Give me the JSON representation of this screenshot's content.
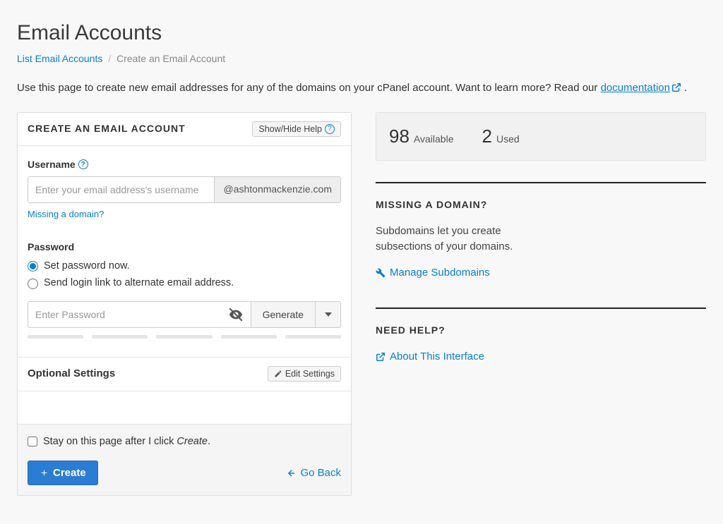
{
  "page_title": "Email Accounts",
  "breadcrumb": {
    "list": "List Email Accounts",
    "current": "Create an Email Account"
  },
  "intro": {
    "text_before": "Use this page to create new email addresses for any of the domains on your cPanel account. Want to learn more? Read our ",
    "link": "documentation",
    "text_after": " ."
  },
  "form": {
    "panel_title": "CREATE AN EMAIL ACCOUNT",
    "show_hide": "Show/Hide Help",
    "username_label": "Username",
    "username_placeholder": "Enter your email address's username",
    "domain_addon": "@ashtonmackenzie.com",
    "missing_domain_link": "Missing a domain?",
    "password_label": "Password",
    "radio_now": "Set password now.",
    "radio_link": "Send login link to alternate email address.",
    "password_placeholder": "Enter Password",
    "generate": "Generate",
    "optional_title": "Optional Settings",
    "edit_settings": "Edit Settings",
    "stay_prefix": "Stay on this page after I click ",
    "stay_em": "Create",
    "stay_suffix": ".",
    "create_btn": "Create",
    "go_back": "Go Back"
  },
  "stats": {
    "available_n": "98",
    "available_l": "Available",
    "used_n": "2",
    "used_l": "Used"
  },
  "missing": {
    "title": "MISSING A DOMAIN?",
    "text": "Subdomains let you create subsections of your domains.",
    "link": "Manage Subdomains"
  },
  "help": {
    "title": "NEED HELP?",
    "link": "About This Interface"
  }
}
